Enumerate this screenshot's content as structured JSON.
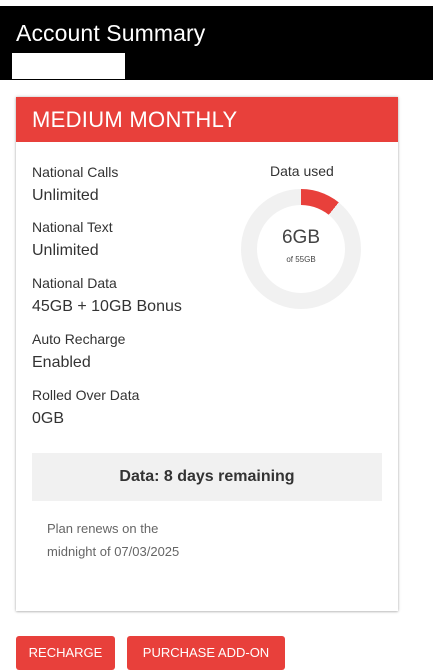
{
  "header": {
    "title": "Account Summary"
  },
  "plan": {
    "name": "MEDIUM MONTHLY",
    "features": [
      {
        "label": "National Calls",
        "value": "Unlimited"
      },
      {
        "label": "National Text",
        "value": "Unlimited"
      },
      {
        "label": "National Data",
        "value": "45GB + 10GB Bonus"
      },
      {
        "label": "Auto Recharge",
        "value": "Enabled"
      },
      {
        "label": "Rolled Over Data",
        "value": "0GB"
      }
    ],
    "data_usage": {
      "label": "Data used",
      "used": "6GB",
      "of_total": "of 55GB",
      "used_fraction": 0.109
    },
    "remaining": "Data: 8 days remaining",
    "renew_note": "Plan renews on the midnight of 07/03/2025"
  },
  "actions": {
    "recharge_label": "RECHARGE",
    "purchase_addon_label": "PURCHASE ADD-ON"
  },
  "colors": {
    "accent": "#e8403b",
    "donut_track": "#f1f1f1",
    "header_bg": "#000000"
  }
}
